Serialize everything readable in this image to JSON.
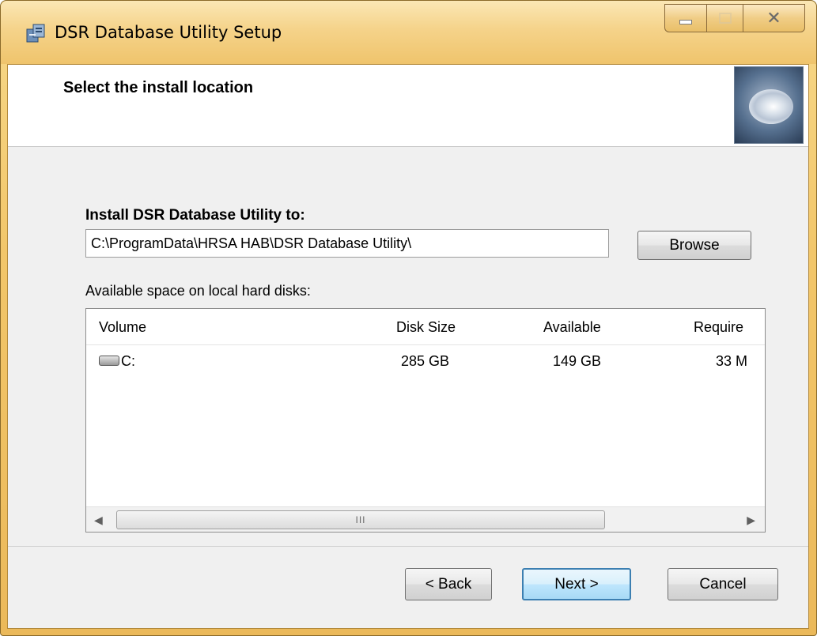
{
  "window": {
    "title": "DSR Database Utility Setup",
    "icon": "installer-icon"
  },
  "banner": {
    "heading": "Select the install location",
    "image": "cd-disc-image"
  },
  "install": {
    "label": "Install DSR Database Utility to:",
    "path": "C:\\ProgramData\\HRSA HAB\\DSR Database Utility\\",
    "browse_label": "Browse"
  },
  "disks": {
    "label": "Available space on local hard disks:",
    "columns": [
      "Volume",
      "Disk Size",
      "Available",
      "Require"
    ],
    "rows": [
      {
        "volume": "C:",
        "disk_size": "285 GB",
        "available": "149 GB",
        "required": "33 M"
      }
    ],
    "scroll_grip": "III"
  },
  "buttons": {
    "back": "< Back",
    "next": "Next >",
    "cancel": "Cancel"
  },
  "colors": {
    "titlebar": "#f5d38a",
    "client": "#f0f0f0",
    "default_button_border": "#3c7fb1"
  }
}
